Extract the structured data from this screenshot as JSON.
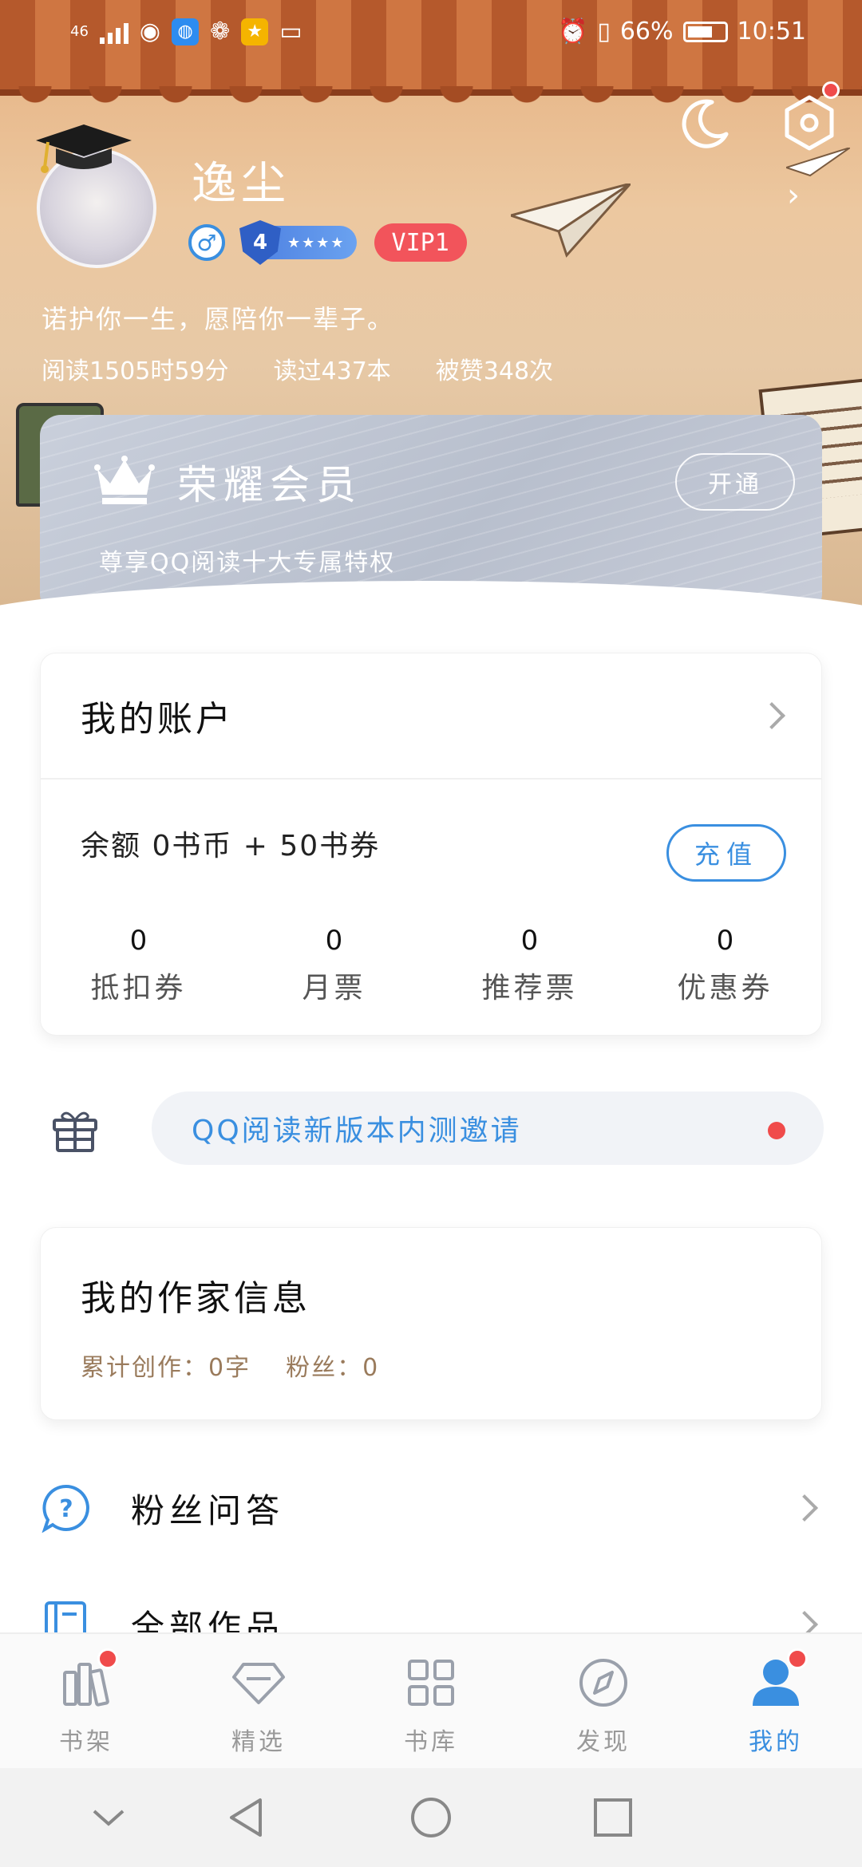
{
  "status_bar": {
    "network": "46",
    "battery": "66%",
    "time": "10:51"
  },
  "profile": {
    "username": "逸尘",
    "level": "4",
    "level_stars": "★★★★",
    "vip_label": "VIP1",
    "signature": "诺护你一生，愿陪你一辈子。",
    "stats": [
      "阅读1505时59分",
      "读过437本",
      "被赞348次"
    ]
  },
  "vip_card": {
    "title": "荣耀会员",
    "subtitle": "尊享QQ阅读十大专属特权",
    "button": "开通"
  },
  "account": {
    "title": "我的账户",
    "balance": "余额  0书币 + 50书券",
    "recharge": "充值",
    "tickets": [
      {
        "count": "0",
        "label": "抵扣券"
      },
      {
        "count": "0",
        "label": "月票"
      },
      {
        "count": "0",
        "label": "推荐票"
      },
      {
        "count": "0",
        "label": "优惠券"
      }
    ]
  },
  "invite": {
    "text": "QQ阅读新版本内测邀请",
    "icon": "gift-icon"
  },
  "writer": {
    "title": "我的作家信息",
    "total": "累计创作：0字",
    "fans": "粉丝：0"
  },
  "menu": [
    {
      "label": "粉丝问答",
      "icon": "question-bubble-icon"
    },
    {
      "label": "全部作品",
      "icon": "book-icon"
    }
  ],
  "nav": [
    {
      "label": "书架",
      "icon": "bookshelf-icon",
      "badge": true
    },
    {
      "label": "精选",
      "icon": "diamond-icon",
      "badge": false
    },
    {
      "label": "书库",
      "icon": "grid-icon",
      "badge": false
    },
    {
      "label": "发现",
      "icon": "compass-icon",
      "badge": false
    },
    {
      "label": "我的",
      "icon": "user-icon",
      "badge": true,
      "active": true
    }
  ],
  "colors": {
    "accent": "#3a8fe0",
    "vip_red": "#f2545b",
    "badge_red": "#f04b4b"
  }
}
